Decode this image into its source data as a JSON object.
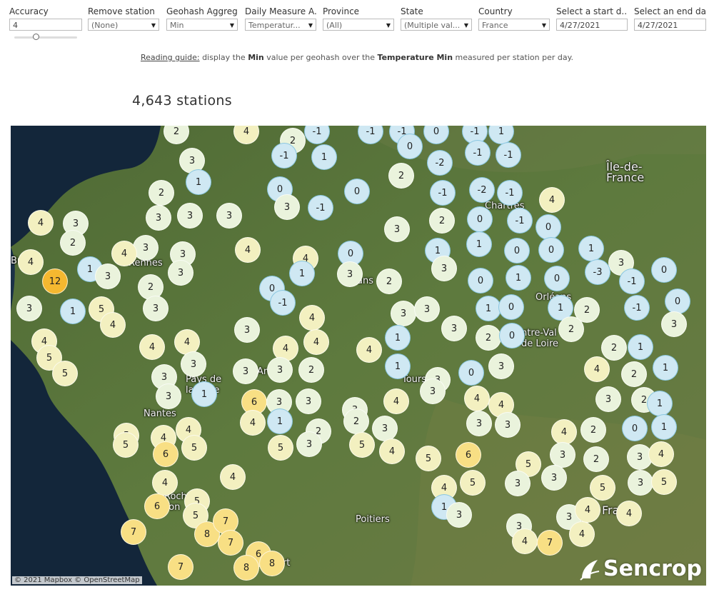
{
  "filters": [
    {
      "label": "Accuracy",
      "value": "4",
      "dropdown": false
    },
    {
      "label": "Remove station",
      "value": "(None)",
      "dropdown": true
    },
    {
      "label": "Geohash Aggreg...",
      "value": "Min",
      "dropdown": true
    },
    {
      "label": "Daily Measure A...",
      "value": "Temperatur...",
      "dropdown": true
    },
    {
      "label": "Province",
      "value": "(All)",
      "dropdown": true
    },
    {
      "label": "State",
      "value": "(Multiple val...",
      "dropdown": true
    },
    {
      "label": "Country",
      "value": "France",
      "dropdown": true
    },
    {
      "label": "Select a start d...",
      "value": "4/27/2021",
      "dropdown": false
    },
    {
      "label": "Select an end da...",
      "value": "4/27/2021",
      "dropdown": false
    }
  ],
  "guide": {
    "prefix": "Reading guide:",
    "t1": " display the ",
    "agg": "Min",
    "t2": "  value per geohash over the ",
    "measure": "Temperature Min",
    "t3": " measured per station per day."
  },
  "station_count": "4,643 stations",
  "places": [
    "Île-de-France",
    "Chartres",
    "Rennes",
    "Orléans",
    "Centre-Val de Loire",
    "Pays de la Loire",
    "Nantes",
    "Tours",
    "Poitiers",
    "France",
    "Bretagne",
    "Le Mans",
    "Angers",
    "La Roche-sur-Yon",
    "Niort"
  ],
  "markers": [
    [
      247,
      184,
      2
    ],
    [
      345,
      184,
      4
    ],
    [
      444,
      184,
      -1
    ],
    [
      519,
      184,
      -1
    ],
    [
      563,
      184,
      -1
    ],
    [
      611,
      184,
      0
    ],
    [
      665,
      184,
      -1
    ],
    [
      702,
      184,
      1
    ],
    [
      410,
      197,
      2
    ],
    [
      574,
      205,
      0
    ],
    [
      398,
      218,
      -1
    ],
    [
      454,
      220,
      1
    ],
    [
      669,
      214,
      -1
    ],
    [
      712,
      217,
      -1
    ],
    [
      269,
      225,
      3
    ],
    [
      616,
      228,
      -2
    ],
    [
      278,
      255,
      1
    ],
    [
      562,
      246,
      2
    ],
    [
      226,
      270,
      2
    ],
    [
      392,
      265,
      0
    ],
    [
      500,
      268,
      0
    ],
    [
      620,
      270,
      -1
    ],
    [
      675,
      266,
      -2
    ],
    [
      714,
      270,
      -1
    ],
    [
      773,
      280,
      4
    ],
    [
      402,
      290,
      3
    ],
    [
      449,
      291,
      -1
    ],
    [
      222,
      305,
      3
    ],
    [
      266,
      302,
      3
    ],
    [
      321,
      302,
      3
    ],
    [
      57,
      312,
      4
    ],
    [
      106,
      313,
      3
    ],
    [
      556,
      321,
      3
    ],
    [
      619,
      309,
      2
    ],
    [
      672,
      307,
      0
    ],
    [
      728,
      309,
      -1
    ],
    [
      768,
      318,
      0
    ],
    [
      102,
      340,
      2
    ],
    [
      204,
      347,
      3
    ],
    [
      174,
      355,
      4
    ],
    [
      256,
      356,
      3
    ],
    [
      347,
      350,
      4
    ],
    [
      428,
      362,
      4
    ],
    [
      491,
      355,
      0
    ],
    [
      613,
      351,
      1
    ],
    [
      671,
      342,
      1
    ],
    [
      724,
      351,
      0
    ],
    [
      772,
      350,
      0
    ],
    [
      828,
      348,
      1
    ],
    [
      43,
      367,
      4
    ],
    [
      126,
      377,
      1
    ],
    [
      151,
      387,
      3
    ],
    [
      253,
      382,
      3
    ],
    [
      423,
      383,
      1
    ],
    [
      490,
      384,
      3
    ],
    [
      622,
      376,
      3
    ],
    [
      870,
      368,
      3
    ],
    [
      930,
      378,
      0
    ],
    [
      77,
      394,
      12
    ],
    [
      545,
      394,
      2
    ],
    [
      673,
      393,
      0
    ],
    [
      726,
      389,
      1
    ],
    [
      780,
      390,
      0
    ],
    [
      837,
      381,
      -3
    ],
    [
      885,
      394,
      -1
    ],
    [
      211,
      402,
      2
    ],
    [
      381,
      404,
      0
    ],
    [
      41,
      432,
      3
    ],
    [
      102,
      436,
      1
    ],
    [
      142,
      433,
      5
    ],
    [
      218,
      432,
      3
    ],
    [
      396,
      424,
      -1
    ],
    [
      565,
      439,
      3
    ],
    [
      598,
      433,
      3
    ],
    [
      684,
      432,
      1
    ],
    [
      716,
      430,
      0
    ],
    [
      785,
      431,
      1
    ],
    [
      822,
      434,
      2
    ],
    [
      892,
      431,
      -1
    ],
    [
      949,
      422,
      0
    ],
    [
      158,
      455,
      4
    ],
    [
      437,
      445,
      4
    ],
    [
      346,
      462,
      3
    ],
    [
      636,
      460,
      3
    ],
    [
      800,
      461,
      2
    ],
    [
      944,
      454,
      3
    ],
    [
      62,
      478,
      4
    ],
    [
      262,
      479,
      4
    ],
    [
      213,
      486,
      4
    ],
    [
      443,
      479,
      4
    ],
    [
      557,
      473,
      1
    ],
    [
      684,
      473,
      2
    ],
    [
      717,
      470,
      0
    ],
    [
      860,
      487,
      2
    ],
    [
      897,
      486,
      1
    ],
    [
      69,
      501,
      5
    ],
    [
      400,
      488,
      4
    ],
    [
      517,
      490,
      4
    ],
    [
      271,
      510,
      3
    ],
    [
      91,
      523,
      5
    ],
    [
      230,
      528,
      3
    ],
    [
      344,
      520,
      3
    ],
    [
      392,
      518,
      3
    ],
    [
      436,
      518,
      2
    ],
    [
      557,
      513,
      1
    ],
    [
      660,
      522,
      0
    ],
    [
      702,
      513,
      3
    ],
    [
      836,
      517,
      4
    ],
    [
      888,
      524,
      2
    ],
    [
      932,
      515,
      1
    ],
    [
      613,
      532,
      3
    ],
    [
      606,
      548,
      3
    ],
    [
      236,
      555,
      3
    ],
    [
      286,
      552,
      1
    ],
    [
      356,
      563,
      6
    ],
    [
      391,
      563,
      3
    ],
    [
      432,
      562,
      3
    ],
    [
      555,
      562,
      4
    ],
    [
      668,
      558,
      4
    ],
    [
      702,
      567,
      4
    ],
    [
      852,
      559,
      3
    ],
    [
      902,
      560,
      2
    ],
    [
      924,
      565,
      1
    ],
    [
      497,
      574,
      3
    ],
    [
      499,
      590,
      2
    ],
    [
      354,
      592,
      4
    ],
    [
      392,
      590,
      1
    ],
    [
      539,
      600,
      3
    ],
    [
      671,
      593,
      3
    ],
    [
      711,
      595,
      3
    ],
    [
      790,
      605,
      4
    ],
    [
      831,
      602,
      2
    ],
    [
      889,
      600,
      0
    ],
    [
      930,
      598,
      1
    ],
    [
      177,
      610,
      5
    ],
    [
      176,
      623,
      5
    ],
    [
      229,
      613,
      4
    ],
    [
      264,
      602,
      4
    ],
    [
      446,
      604,
      2
    ],
    [
      232,
      636,
      6
    ],
    [
      272,
      627,
      5
    ],
    [
      393,
      627,
      5
    ],
    [
      433,
      622,
      3
    ],
    [
      507,
      623,
      5
    ],
    [
      549,
      632,
      4
    ],
    [
      600,
      642,
      5
    ],
    [
      656,
      637,
      6
    ],
    [
      788,
      637,
      3
    ],
    [
      835,
      643,
      2
    ],
    [
      896,
      640,
      3
    ],
    [
      926,
      636,
      4
    ],
    [
      326,
      668,
      4
    ],
    [
      231,
      676,
      4
    ],
    [
      740,
      650,
      5
    ],
    [
      622,
      683,
      4
    ],
    [
      662,
      676,
      5
    ],
    [
      725,
      677,
      3
    ],
    [
      776,
      669,
      3
    ],
    [
      844,
      683,
      5
    ],
    [
      897,
      676,
      3
    ],
    [
      930,
      675,
      5
    ],
    [
      220,
      709,
      6
    ],
    [
      276,
      702,
      5
    ],
    [
      274,
      722,
      5
    ],
    [
      622,
      710,
      1
    ],
    [
      643,
      721,
      3
    ],
    [
      797,
      724,
      3
    ],
    [
      823,
      714,
      4
    ],
    [
      881,
      719,
      4
    ],
    [
      187,
      745,
      7
    ],
    [
      290,
      748,
      8
    ],
    [
      316,
      730,
      7
    ],
    [
      323,
      760,
      7
    ],
    [
      727,
      737,
      3
    ],
    [
      735,
      758,
      4
    ],
    [
      770,
      760,
      7
    ],
    [
      815,
      748,
      4
    ],
    [
      362,
      776,
      6
    ],
    [
      381,
      789,
      8
    ],
    [
      345,
      795,
      8
    ],
    [
      253,
      794,
      7
    ]
  ],
  "credit": "© 2021 Mapbox  © OpenStreetMap",
  "brand": "Sencrop",
  "colors": {
    "cold": "#cfe8f3",
    "mild": "#eaf3dc",
    "warm": "#f3f0c0",
    "hot": "#f8df84",
    "hottest": "#f5b830"
  }
}
